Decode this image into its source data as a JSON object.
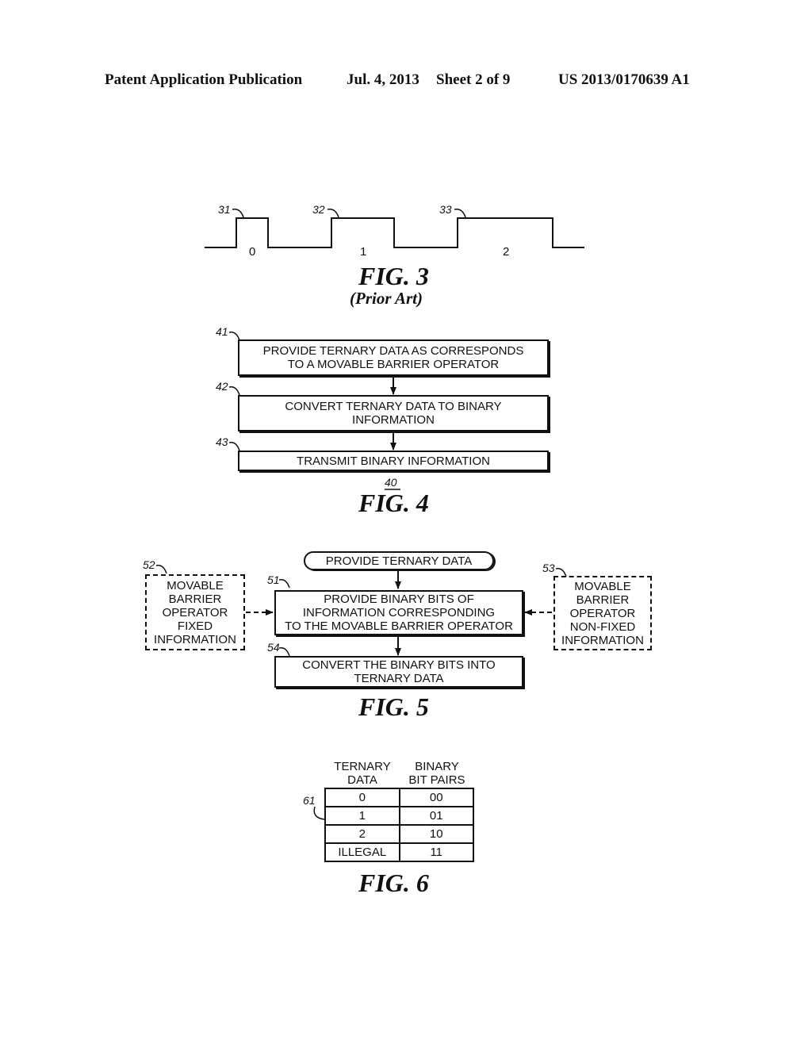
{
  "header": {
    "publication": "Patent Application Publication",
    "date": "Jul. 4, 2013",
    "sheet": "Sheet 2 of 9",
    "number": "US 2013/0170639 A1"
  },
  "fig3": {
    "caption": "FIG. 3",
    "subcaption": "(Prior Art)",
    "pulses": [
      {
        "ref": "31",
        "value": "0"
      },
      {
        "ref": "32",
        "value": "1"
      },
      {
        "ref": "33",
        "value": "2"
      }
    ]
  },
  "fig4": {
    "caption": "FIG. 4",
    "ref": "40",
    "steps": [
      {
        "ref": "41",
        "line1": "PROVIDE TERNARY DATA AS CORRESPONDS",
        "line2": "TO A MOVABLE BARRIER OPERATOR"
      },
      {
        "ref": "42",
        "line1": "CONVERT TERNARY DATA TO BINARY",
        "line2": "INFORMATION"
      },
      {
        "ref": "43",
        "line1": "TRANSMIT BINARY INFORMATION"
      }
    ]
  },
  "fig5": {
    "caption": "FIG. 5",
    "start": "PROVIDE TERNARY DATA",
    "step51": {
      "ref": "51",
      "line1": "PROVIDE BINARY BITS OF",
      "line2": "INFORMATION CORRESPONDING",
      "line3": "TO THE MOVABLE BARRIER OPERATOR"
    },
    "step54": {
      "ref": "54",
      "line1": "CONVERT THE BINARY BITS INTO",
      "line2": "TERNARY DATA"
    },
    "input52": {
      "ref": "52",
      "lines": [
        "MOVABLE",
        "BARRIER",
        "OPERATOR",
        "FIXED",
        "INFORMATION"
      ]
    },
    "input53": {
      "ref": "53",
      "lines": [
        "MOVABLE",
        "BARRIER",
        "OPERATOR",
        "NON-FIXED",
        "INFORMATION"
      ]
    }
  },
  "fig6": {
    "caption": "FIG. 6",
    "ref": "61",
    "headers": [
      [
        "TERNARY",
        "DATA"
      ],
      [
        "BINARY",
        "BIT PAIRS"
      ]
    ],
    "rows": [
      [
        "0",
        "00"
      ],
      [
        "1",
        "01"
      ],
      [
        "2",
        "10"
      ],
      [
        "ILLEGAL",
        "11"
      ]
    ]
  }
}
